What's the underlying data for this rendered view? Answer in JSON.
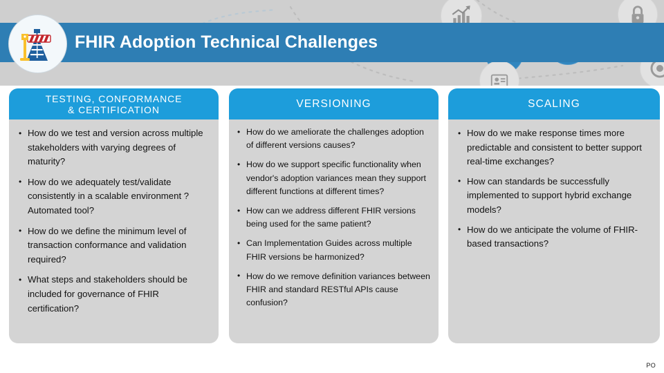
{
  "header": {
    "title": "FHIR Adoption Technical Challenges",
    "logo_icon": "road-barrier-icon",
    "bar_color": "#2e7eb4",
    "band_color": "#cfcfcf"
  },
  "decor": {
    "icons": [
      "bar-chart-growth-icon",
      "lock-icon",
      "document-stack-icon",
      "people-group-icon",
      "id-badge-icon",
      "at-target-icon"
    ]
  },
  "columns": [
    {
      "id": "testing-conformance-certification",
      "heading": "TESTING, CONFORMANCE & CERTIFICATION",
      "heading_lines": [
        "TESTING, CONFORMANCE",
        "& CERTIFICATION"
      ],
      "header_color": "#1d9ddb",
      "bullets": [
        "How do we test and version across multiple stakeholders with varying degrees of maturity?",
        "How do we adequately test/validate consistently in a scalable environment ? Automated tool?",
        "How do we define the minimum level of transaction conformance and validation required?",
        "What steps and stakeholders should be included for governance of FHIR certification?"
      ]
    },
    {
      "id": "versioning",
      "heading": "VERSIONING",
      "heading_lines": [
        "VERSIONING"
      ],
      "header_color": "#1d9ddb",
      "bullets": [
        "How do we ameliorate the challenges adoption of different versions causes?",
        "How do we support specific functionality when vendor's adoption variances mean they support different functions at different times?",
        "How can we address different FHIR versions being used for the same patient?",
        "Can Implementation Guides across multiple FHIR versions be harmonized?",
        "How do we remove definition variances between FHIR and standard RESTful APIs cause confusion?"
      ]
    },
    {
      "id": "scaling",
      "heading": "SCALING",
      "heading_lines": [
        "SCALING"
      ],
      "header_color": "#1d9ddb",
      "bullets": [
        "How do we make response times more predictable and consistent to better support real-time exchanges?",
        "How can standards be successfully implemented to support hybrid exchange models?",
        "How do we anticipate the volume of FHIR-based transactions?"
      ]
    }
  ],
  "footer": {
    "note": "PO"
  }
}
